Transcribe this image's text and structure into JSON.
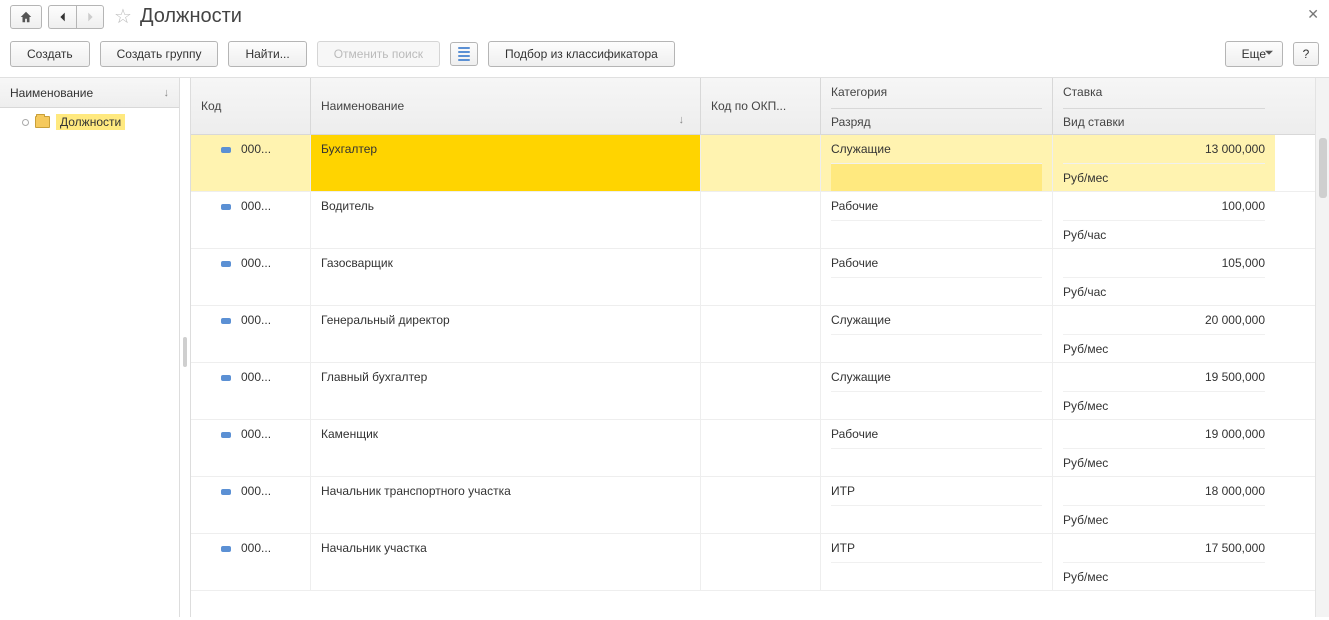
{
  "title": "Должности",
  "toolbar": {
    "create": "Создать",
    "create_group": "Создать группу",
    "find": "Найти...",
    "cancel_find": "Отменить поиск",
    "pick_from_classifier": "Подбор из классификатора",
    "more": "Еще",
    "help": "?"
  },
  "left_pane": {
    "header": "Наименование",
    "root_item": "Должности"
  },
  "grid": {
    "headers": {
      "code": "Код",
      "name": "Наименование",
      "okp": "Код по ОКП...",
      "category_top": "Категория",
      "category_sub": "Разряд",
      "rate_top": "Ставка",
      "rate_sub": "Вид ставки"
    },
    "rows": [
      {
        "code": "000...",
        "name": "Бухгалтер",
        "okp": "",
        "category": "Служащие",
        "grade": "",
        "rate": "13 000,000",
        "rate_type": "Руб/мес",
        "selected": true
      },
      {
        "code": "000...",
        "name": "Водитель",
        "okp": "",
        "category": "Рабочие",
        "grade": "",
        "rate": "100,000",
        "rate_type": "Руб/час",
        "selected": false
      },
      {
        "code": "000...",
        "name": "Газосварщик",
        "okp": "",
        "category": "Рабочие",
        "grade": "",
        "rate": "105,000",
        "rate_type": "Руб/час",
        "selected": false
      },
      {
        "code": "000...",
        "name": "Генеральный директор",
        "okp": "",
        "category": "Служащие",
        "grade": "",
        "rate": "20 000,000",
        "rate_type": "Руб/мес",
        "selected": false
      },
      {
        "code": "000...",
        "name": "Главный бухгалтер",
        "okp": "",
        "category": "Служащие",
        "grade": "",
        "rate": "19 500,000",
        "rate_type": "Руб/мес",
        "selected": false
      },
      {
        "code": "000...",
        "name": "Каменщик",
        "okp": "",
        "category": "Рабочие",
        "grade": "",
        "rate": "19 000,000",
        "rate_type": "Руб/мес",
        "selected": false
      },
      {
        "code": "000...",
        "name": "Начальник транспортного участка",
        "okp": "",
        "category": "ИТР",
        "grade": "",
        "rate": "18 000,000",
        "rate_type": "Руб/мес",
        "selected": false
      },
      {
        "code": "000...",
        "name": "Начальник участка",
        "okp": "",
        "category": "ИТР",
        "grade": "",
        "rate": "17 500,000",
        "rate_type": "Руб/мес",
        "selected": false
      }
    ]
  }
}
